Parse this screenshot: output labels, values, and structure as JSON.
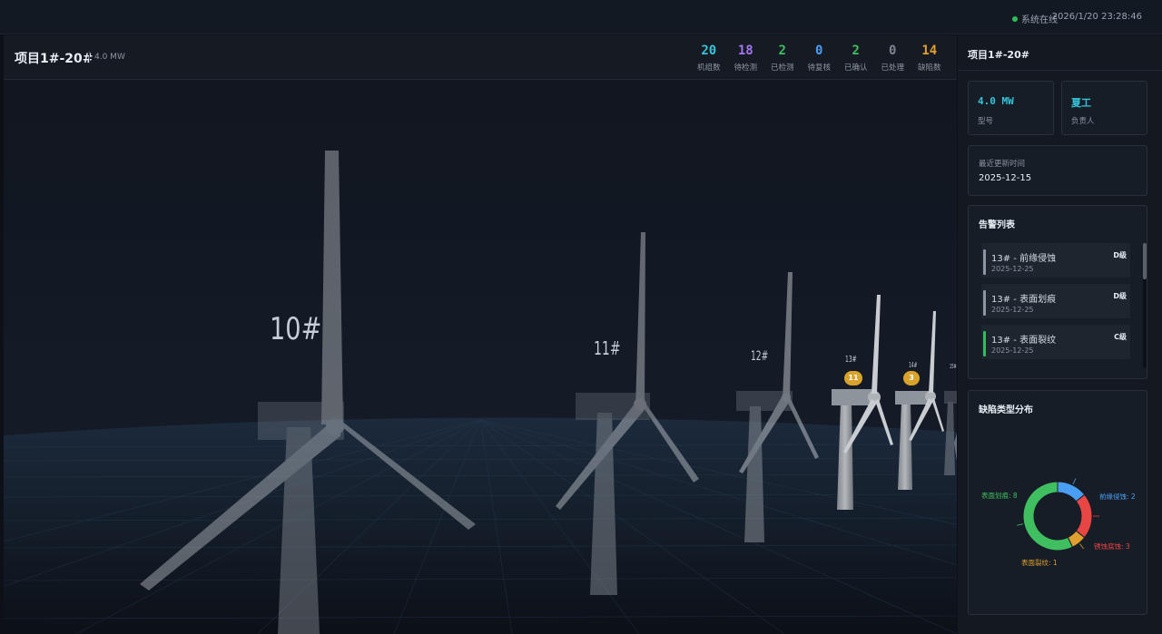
{
  "topbar": {
    "status": "系统在线",
    "datetime": "2026/1/20 23:28:46"
  },
  "project": {
    "title": "项目1#-20#",
    "capacity": "4.0 MW"
  },
  "stats": [
    {
      "value": "20",
      "label": "机组数",
      "color": "#35c4d9"
    },
    {
      "value": "18",
      "label": "待检测",
      "color": "#a374f0"
    },
    {
      "value": "2",
      "label": "已检测",
      "color": "#3fbf5f"
    },
    {
      "value": "0",
      "label": "待复核",
      "color": "#4a9ff5"
    },
    {
      "value": "2",
      "label": "已确认",
      "color": "#3fbf5f"
    },
    {
      "value": "0",
      "label": "已处理",
      "color": "#7d8590"
    },
    {
      "value": "14",
      "label": "缺陷数",
      "color": "#e0a030"
    }
  ],
  "scene": {
    "turbines": [
      {
        "label": "10#"
      },
      {
        "label": "11#"
      },
      {
        "label": "12#"
      },
      {
        "label": "13#",
        "badge": "11"
      },
      {
        "label": "14#",
        "badge": "3"
      },
      {
        "label": "15#"
      }
    ]
  },
  "side": {
    "title": "项目1#-20#",
    "model": {
      "value": "4.0 MW",
      "label": "型号"
    },
    "owner": {
      "value": "夏工",
      "label": "负责人"
    },
    "updated": {
      "label": "最近更新时间",
      "value": "2025-12-15"
    },
    "alarm_title": "告警列表",
    "alarms": [
      {
        "name": "13# - 前缘侵蚀",
        "date": "2025-12-25",
        "level": "D级",
        "color": "#8b95a3"
      },
      {
        "name": "13# - 表面划痕",
        "date": "2025-12-25",
        "level": "D级",
        "color": "#8b95a3"
      },
      {
        "name": "13# - 表面裂纹",
        "date": "2025-12-25",
        "level": "C级",
        "color": "#2fbd5a"
      }
    ],
    "defect_title": "缺陷类型分布"
  },
  "chart_data": {
    "type": "pie",
    "title": "缺陷类型分布",
    "categories": [
      "表面划痕",
      "前缘侵蚀",
      "锈蚀腐蚀",
      "表面裂纹"
    ],
    "values": [
      8,
      2,
      3,
      1
    ],
    "labels": [
      "表面划痕: 8",
      "前缘侵蚀: 2",
      "锈蚀腐蚀: 3",
      "表面裂纹: 1"
    ],
    "colors": [
      "#3fbf5f",
      "#4a9ff5",
      "#e84545",
      "#e0a030"
    ]
  }
}
